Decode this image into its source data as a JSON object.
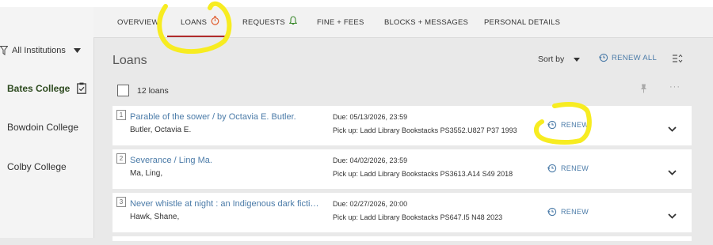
{
  "tabs": [
    {
      "label": "OVERVIEW"
    },
    {
      "label": "LOANS"
    },
    {
      "label": "REQUESTS"
    },
    {
      "label": "FINE + FEES"
    },
    {
      "label": "BLOCKS + MESSAGES"
    },
    {
      "label": "PERSONAL DETAILS"
    }
  ],
  "sidebar": {
    "filter_label": "All Institutions",
    "colleges": [
      {
        "label": "Bates College"
      },
      {
        "label": "Bowdoin College"
      },
      {
        "label": "Colby College"
      }
    ]
  },
  "main": {
    "title": "Loans",
    "sort_label": "Sort by",
    "renew_all_label": "RENEW ALL",
    "loan_count": "12 loans",
    "loans": [
      {
        "number": "1",
        "title": "Parable of the sower / by Octavia E. Butler.",
        "author": "Butler, Octavia E.",
        "due": "Due: 05/13/2026, 23:59",
        "pickup": "Pick up: Ladd Library Bookstacks PS3552.U827 P37 1993",
        "renew_label": "RENEW"
      },
      {
        "number": "2",
        "title": "Severance / Ling Ma.",
        "author": "Ma, Ling,",
        "due": "Due: 04/02/2026, 23:59",
        "pickup": "Pick up: Ladd Library Bookstacks PS3613.A14 S49 2018",
        "renew_label": "RENEW"
      },
      {
        "number": "3",
        "title": "Never whistle at night : an Indigenous dark fiction anthology",
        "author": "Hawk, Shane,",
        "due": "Due: 02/27/2026, 20:00",
        "pickup": "Pick up: Ladd Library Bookstacks PS647.I5 N48 2023",
        "renew_label": "RENEW"
      }
    ]
  },
  "icons": {
    "filter": "filter-icon",
    "dropdown": "chevron-down-icon",
    "institution_card": "clipboard-check-icon",
    "loans_tab": "stopwatch-icon",
    "requests_tab": "bell-icon",
    "renew": "clock-renew-icon",
    "sort_toggle": "sort-toggle-icon",
    "pin": "pin-icon",
    "more": "more-icon"
  },
  "colors": {
    "link": "#4b7ba8",
    "active_tab_underline": "#b02b2b",
    "loans_icon": "#e05a2b",
    "requests_icon": "#3c8a2e",
    "highlight": "#f7ec21"
  }
}
